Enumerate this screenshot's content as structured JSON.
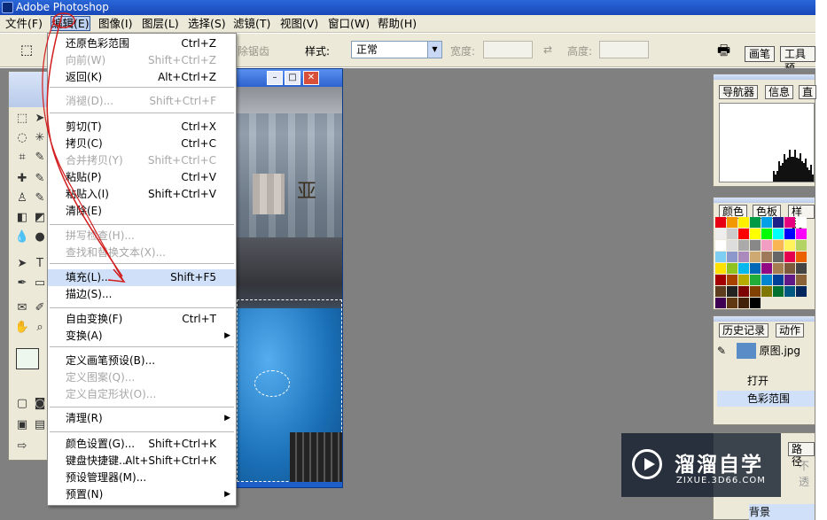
{
  "titlebar": {
    "title": "Adobe Photoshop"
  },
  "menubar": [
    "文件(F)",
    "编辑(E)",
    "图像(I)",
    "图层(L)",
    "选择(S)",
    "滤镜(T)",
    "视图(V)",
    "窗口(W)",
    "帮助(H)"
  ],
  "options": {
    "antialias": "除锯齿",
    "style_label": "样式:",
    "style_value": "正常",
    "width_label": "宽度:",
    "height_label": "高度:",
    "tabs": [
      "画笔",
      "工具预"
    ]
  },
  "edit_menu": {
    "items": [
      {
        "label": "还原色彩范围",
        "shortcut": "Ctrl+Z",
        "disabled": false
      },
      {
        "label": "向前(W)",
        "shortcut": "Shift+Ctrl+Z",
        "disabled": true
      },
      {
        "label": "返回(K)",
        "shortcut": "Alt+Ctrl+Z",
        "disabled": false
      },
      {
        "label": "消褪(D)...",
        "shortcut": "Shift+Ctrl+F",
        "disabled": true
      },
      {
        "label": "剪切(T)",
        "shortcut": "Ctrl+X",
        "disabled": false
      },
      {
        "label": "拷贝(C)",
        "shortcut": "Ctrl+C",
        "disabled": false
      },
      {
        "label": "合并拷贝(Y)",
        "shortcut": "Shift+Ctrl+C",
        "disabled": true
      },
      {
        "label": "粘贴(P)",
        "shortcut": "Ctrl+V",
        "disabled": false
      },
      {
        "label": "粘贴入(I)",
        "shortcut": "Shift+Ctrl+V",
        "disabled": false
      },
      {
        "label": "清除(E)",
        "shortcut": "",
        "disabled": false
      },
      {
        "label": "拼写检查(H)...",
        "shortcut": "",
        "disabled": true
      },
      {
        "label": "查找和替换文本(X)...",
        "shortcut": "",
        "disabled": true
      },
      {
        "label": "填充(L)...",
        "shortcut": "Shift+F5",
        "disabled": false,
        "highlighted": true
      },
      {
        "label": "描边(S)...",
        "shortcut": "",
        "disabled": false
      },
      {
        "label": "自由变换(F)",
        "shortcut": "Ctrl+T",
        "disabled": false
      },
      {
        "label": "变换(A)",
        "shortcut": "",
        "disabled": false,
        "submenu": true
      },
      {
        "label": "定义画笔预设(B)...",
        "shortcut": "",
        "disabled": false
      },
      {
        "label": "定义图案(Q)...",
        "shortcut": "",
        "disabled": true
      },
      {
        "label": "定义自定形状(O)...",
        "shortcut": "",
        "disabled": true
      },
      {
        "label": "清理(R)",
        "shortcut": "",
        "disabled": false,
        "submenu": true
      },
      {
        "label": "颜色设置(G)...",
        "shortcut": "Shift+Ctrl+K",
        "disabled": false
      },
      {
        "label": "键盘快捷键...",
        "shortcut": "Alt+Shift+Ctrl+K",
        "disabled": false
      },
      {
        "label": "预设管理器(M)...",
        "shortcut": "",
        "disabled": false
      },
      {
        "label": "预置(N)",
        "shortcut": "",
        "disabled": false,
        "submenu": true
      }
    ]
  },
  "panels": {
    "navigator_tabs": [
      "导航器",
      "信息",
      "直"
    ],
    "color_tabs": [
      "颜色",
      "色板",
      "样式"
    ],
    "history_tabs": [
      "历史记录",
      "动作"
    ],
    "history_snapshot": "原图.jpg",
    "history_steps": [
      "打开",
      "色彩范围"
    ],
    "layers_tab": "路径",
    "layers_opacity_label": "不透",
    "layer_name": "背景"
  },
  "watermark": {
    "name": "溜溜自学",
    "url": "ZIXUE.3D66.COM"
  },
  "colors": {
    "accent": "#31569c",
    "swatches": [
      "#e60012",
      "#f39800",
      "#fff100",
      "#009944",
      "#00a0e9",
      "#1d2088",
      "#e4007f",
      "#ffffff",
      "#eeeeee",
      "#cccccc",
      "#ff0000",
      "#ffff00",
      "#00ff00",
      "#00ffff",
      "#0000ff",
      "#ff00ff",
      "#ffffff",
      "#dddddd",
      "#aaaaaa",
      "#888888",
      "#f19ec2",
      "#f8b551",
      "#fff45c",
      "#b3d465",
      "#7ecef4",
      "#8c97cb",
      "#aa89bd",
      "#cfa972",
      "#9e7a5a",
      "#666666",
      "#e5004f",
      "#eb6100",
      "#ffe100",
      "#8fc31f",
      "#00b7ee",
      "#0068b7",
      "#920783",
      "#a67c52",
      "#7d5a3c",
      "#444444",
      "#a40000",
      "#a84200",
      "#b7aa00",
      "#22ac38",
      "#0086d1",
      "#004098",
      "#601986",
      "#8c6239",
      "#5e3c1e",
      "#222222",
      "#7d0000",
      "#804000",
      "#807700",
      "#007130",
      "#005982",
      "#00275d",
      "#3e0052",
      "#603913",
      "#42210b",
      "#000000"
    ]
  }
}
